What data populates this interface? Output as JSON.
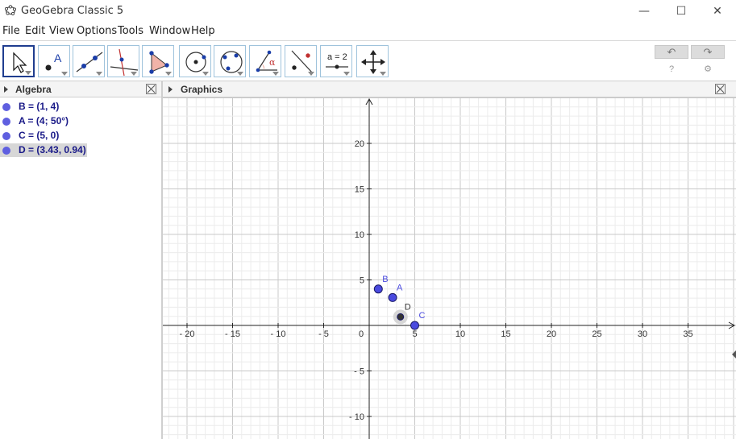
{
  "window": {
    "title": "GeoGebra Classic 5",
    "minimize": "—",
    "maximize": "☐",
    "close": "✕"
  },
  "menu": [
    "File",
    "Edit",
    "View",
    "Options",
    "Tools",
    "Window",
    "Help"
  ],
  "toolbar": {
    "tools": [
      "move-tool",
      "point-tool",
      "line-tool",
      "perpendicular-line-tool",
      "polygon-tool",
      "circle-tool",
      "conic-tool",
      "angle-tool",
      "reflect-tool",
      "slider-tool",
      "move-graphics-view-tool"
    ],
    "slider_label": "a = 2",
    "undo": "↶",
    "redo": "↷",
    "help": "?",
    "settings": "⚙"
  },
  "algebra": {
    "title": "Algebra",
    "items": [
      {
        "text": "B = (1, 4)",
        "selected": false
      },
      {
        "text": "A = (4; 50°)",
        "selected": false
      },
      {
        "text": "C = (5, 0)",
        "selected": false
      },
      {
        "text": "D = (3.43, 0.94)",
        "selected": true
      }
    ]
  },
  "graphics": {
    "title": "Graphics",
    "x_ticks": [
      -20,
      -15,
      -10,
      -5,
      0,
      5,
      10,
      15,
      20,
      25,
      30,
      35
    ],
    "y_ticks": [
      20,
      15,
      10,
      5,
      -5,
      -10
    ],
    "x_tick_labels": [
      "- 20",
      "- 15",
      "- 10",
      "- 5",
      "0",
      "5",
      "10",
      "15",
      "20",
      "25",
      "30",
      "35"
    ],
    "y_tick_labels": [
      "20",
      "15",
      "10",
      "5",
      "- 5",
      "- 10"
    ],
    "points": [
      {
        "label": "B",
        "x": 1,
        "y": 4,
        "color": "#4a4adf"
      },
      {
        "label": "A",
        "x": 2.57,
        "y": 3.06,
        "color": "#4a4adf"
      },
      {
        "label": "C",
        "x": 5,
        "y": 0,
        "color": "#4a4adf"
      },
      {
        "label": "D",
        "x": 3.43,
        "y": 0.94,
        "color": "#333333"
      }
    ]
  }
}
